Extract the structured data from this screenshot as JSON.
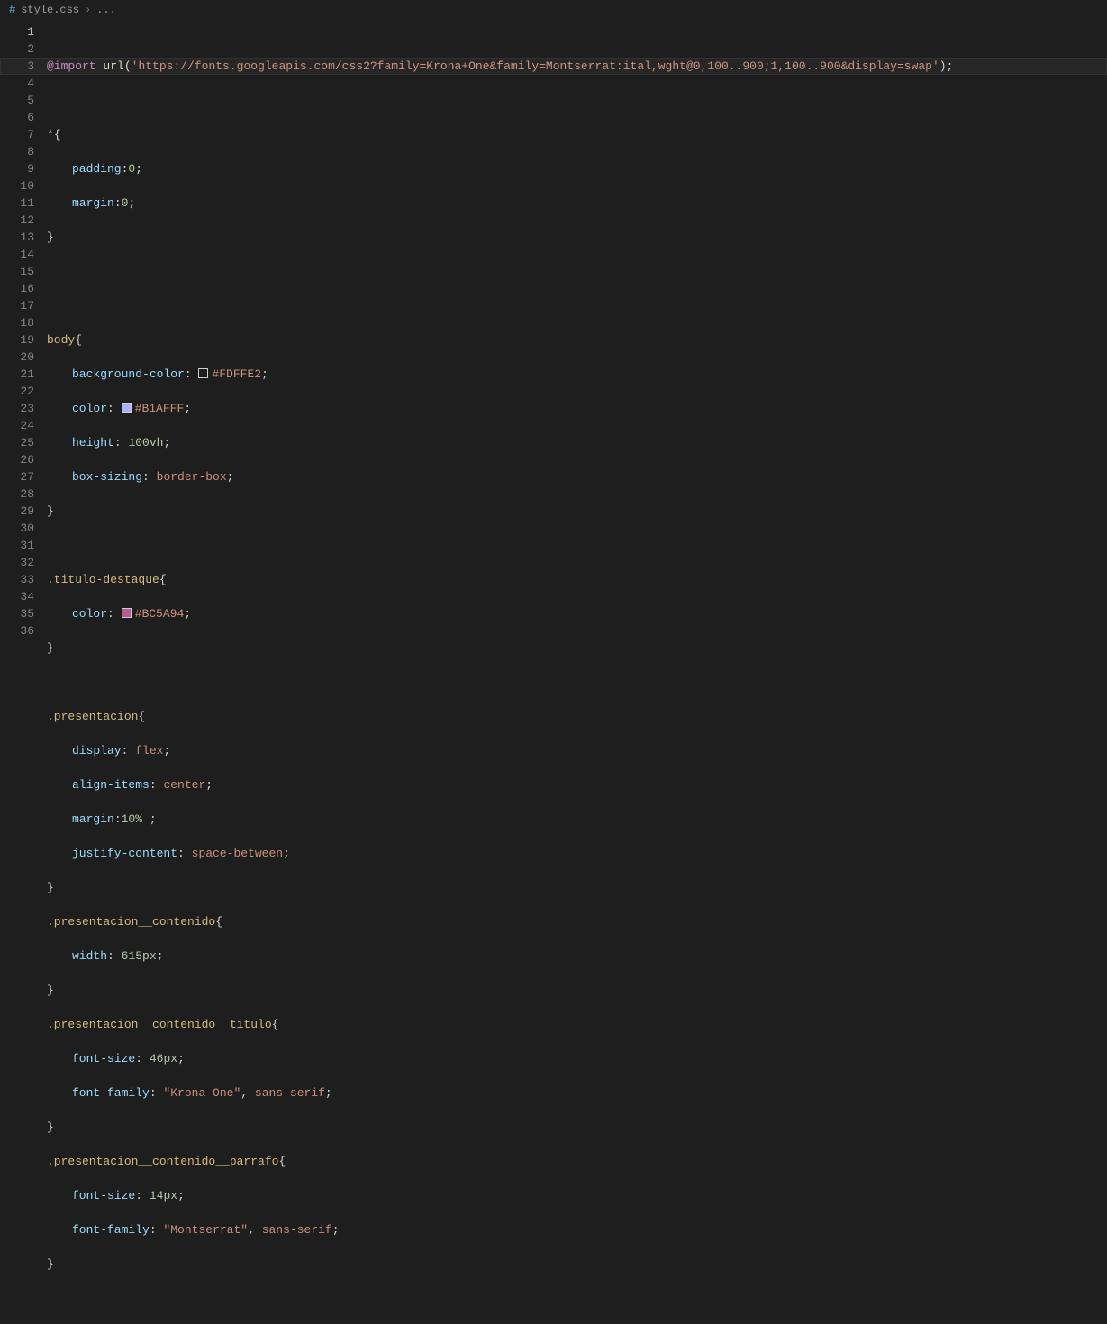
{
  "breadcrumb": {
    "file_icon": "#",
    "file_name": "style.css",
    "separator": "›",
    "trail": "..."
  },
  "gutter": {
    "start": 1,
    "end": 36,
    "current": 1
  },
  "tokens": {
    "at_import": "@import",
    "url": "url",
    "lp": "(",
    "rp": ")",
    "sc": ";",
    "lb": "{",
    "rb": "}",
    "colon": ":",
    "comma": ",",
    "import_url": "'https://fonts.googleapis.com/css2?family=Krona+One&family=Montserrat:ital,wght@0,100..900;1,100..900&display=swap'",
    "sel_star": "*",
    "sel_body": "body",
    "sel_titulo": ".titulo-destaque",
    "sel_presentacion": ".presentacion",
    "sel_pres_cont": ".presentacion__contenido",
    "sel_pres_titulo": ".presentacion__contenido__titulo",
    "sel_pres_parrafo": ".presentacion__contenido__parrafo",
    "p_padding": "padding",
    "p_margin": "margin",
    "p_bgcolor": "background-color",
    "p_color": "color",
    "p_height": "height",
    "p_boxsizing": "box-sizing",
    "p_display": "display",
    "p_alignitems": "align-items",
    "p_justify": "justify-content",
    "p_width": "width",
    "p_fontsize": "font-size",
    "p_fontfamily": "font-family",
    "v_0": "0",
    "v_FDFFE2": "#FDFFE2",
    "v_B1AFFF": "#B1AFFF",
    "v_BC5A94": "#BC5A94",
    "v_100vh": "100vh",
    "v_borderbox": "border-box",
    "v_flex": "flex",
    "v_center": "center",
    "v_10pct": "10%",
    "v_615px": "615px",
    "v_46px": "46px",
    "v_14px": "14px",
    "v_spacebetween": "space-between",
    "v_krona": "\"Krona One\"",
    "v_montserrat": "\"Montserrat\"",
    "v_sansserif": "sans-serif",
    "sp": " "
  },
  "colors": {
    "FDFFE2": "#FDFFE2",
    "B1AFFF": "#B1AFFF",
    "BC5A94": "#BC5A94"
  }
}
